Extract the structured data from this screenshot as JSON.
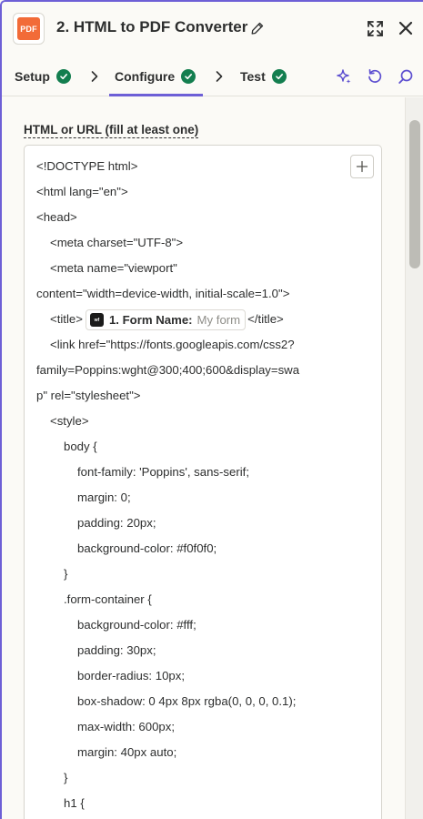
{
  "header": {
    "logo_text": "PDF",
    "title": "2. HTML to PDF Converter"
  },
  "tabs": [
    {
      "label": "Setup",
      "status": "complete"
    },
    {
      "label": "Configure",
      "status": "complete",
      "active": true
    },
    {
      "label": "Test",
      "status": "complete"
    }
  ],
  "colors": {
    "accent": "#6d5fd6",
    "success": "#137e4f",
    "brand_logo": "#f26b38"
  },
  "field": {
    "label": "HTML or URL (fill at least one)"
  },
  "pill": {
    "app_icon": "webflow-icon",
    "label": "1. Form Name:",
    "value": "My form"
  },
  "code_lines": {
    "l1": "<!DOCTYPE html>",
    "l2": "<html lang=\"en\">",
    "l3": "<head>",
    "l4": "<meta charset=\"UTF-8\">",
    "l5": "<meta name=\"viewport\"",
    "l6": "content=\"width=device-width, initial-scale=1.0\">",
    "l7_before": "<title>",
    "l7_after": "</title>",
    "l8": "<link href=\"https://fonts.googleapis.com/css2?",
    "l9": "family=Poppins:wght@300;400;600&display=swa",
    "l10": "p\" rel=\"stylesheet\">",
    "l11": "<style>",
    "l12": "body {",
    "l13": "font-family: 'Poppins', sans-serif;",
    "l14": "margin: 0;",
    "l15": "padding: 20px;",
    "l16": "background-color: #f0f0f0;",
    "l17": "}",
    "l18": ".form-container {",
    "l19": "background-color: #fff;",
    "l20": "padding: 30px;",
    "l21": "border-radius: 10px;",
    "l22": "box-shadow: 0 4px 8px rgba(0, 0, 0, 0.1);",
    "l23": "max-width: 600px;",
    "l24": "margin: 40px auto;",
    "l25": "}",
    "l26": "h1 {"
  }
}
